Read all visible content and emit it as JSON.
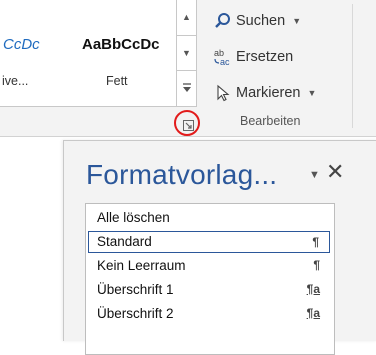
{
  "ribbon": {
    "gallery": {
      "styles": [
        {
          "preview": "CcDc",
          "name": "ive..."
        },
        {
          "preview": "AaBbCcDc",
          "name": "Fett"
        }
      ]
    },
    "editing": {
      "find_label": "Suchen",
      "replace_label": "Ersetzen",
      "select_label": "Markieren",
      "group_label": "Bearbeiten"
    },
    "colors": {
      "accent": "#2b579a",
      "highlight": "#e21b1b"
    }
  },
  "styles_pane": {
    "title": "Formatvorlag...",
    "close_glyph": "✕",
    "dropdown_glyph": "▼",
    "items": [
      {
        "label": "Alle löschen",
        "mark": ""
      },
      {
        "label": "Standard",
        "mark": "¶"
      },
      {
        "label": "Kein Leerraum",
        "mark": "¶"
      },
      {
        "label": "Überschrift 1",
        "mark": "¶a"
      },
      {
        "label": "Überschrift 2",
        "mark": "¶a"
      }
    ],
    "selected_item": "Standard"
  }
}
